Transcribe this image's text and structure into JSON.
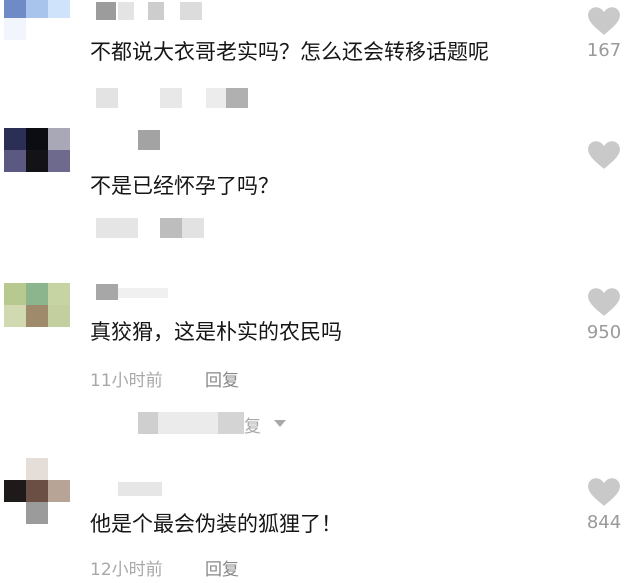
{
  "comments": [
    {
      "text": "不都说大衣哥老实吗？怎么还会转移话题呢",
      "likes": "167",
      "time": "",
      "reply": ""
    },
    {
      "text": "不是已经怀孕了吗？",
      "likes": "",
      "time": "",
      "reply": ""
    },
    {
      "text": "真狡猾，这是朴实的农民吗",
      "likes": "950",
      "time": "11小时前",
      "reply": "回复"
    },
    {
      "text": "他是个最会伪装的狐狸了！",
      "likes": "844",
      "time": "12小时前",
      "reply": "回复"
    }
  ],
  "thread": {
    "expand_label": "复"
  },
  "icons": {
    "like": "heart-icon",
    "expand": "triangle-down-icon"
  },
  "colors": {
    "heart": "#c9c9c9",
    "meta": "#a8a8a8",
    "text": "#161616"
  }
}
